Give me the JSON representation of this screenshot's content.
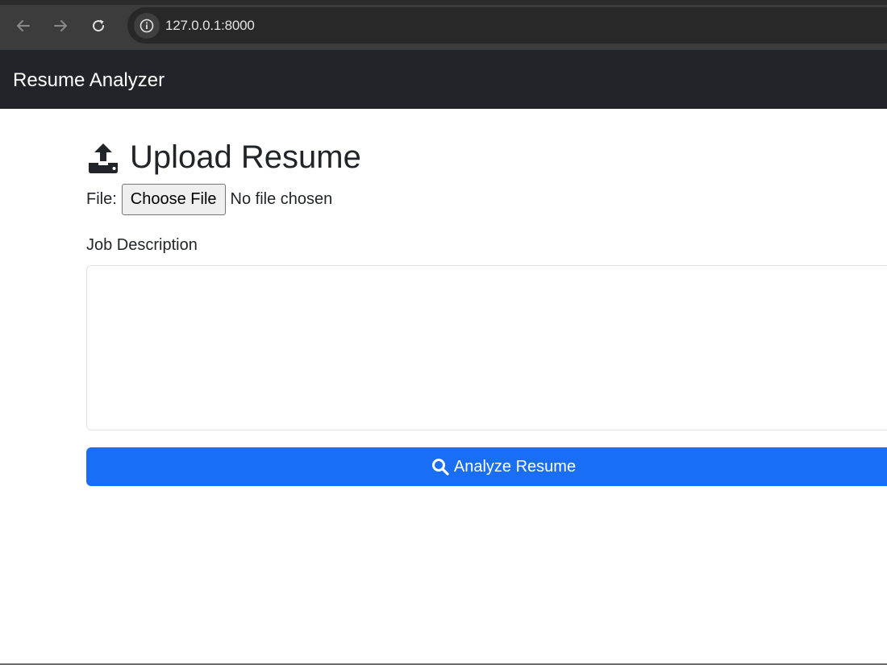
{
  "browser": {
    "url": "127.0.0.1:8000",
    "icons": {
      "back": "arrow-left-icon",
      "forward": "arrow-right-icon",
      "reload": "reload-icon",
      "site_info": "info-icon"
    }
  },
  "navbar": {
    "brand": "Resume Analyzer"
  },
  "form": {
    "heading": "Upload Resume",
    "heading_icon": "upload-icon",
    "file_label": "File:",
    "choose_file_label": "Choose File",
    "file_status": "No file chosen",
    "job_description_label": "Job Description",
    "job_description_value": "",
    "submit_label": "Analyze Resume",
    "submit_icon": "search-icon"
  },
  "colors": {
    "navbar_bg": "#212529",
    "primary": "#1a6ef5",
    "chrome_bg": "#3c3c3c"
  }
}
